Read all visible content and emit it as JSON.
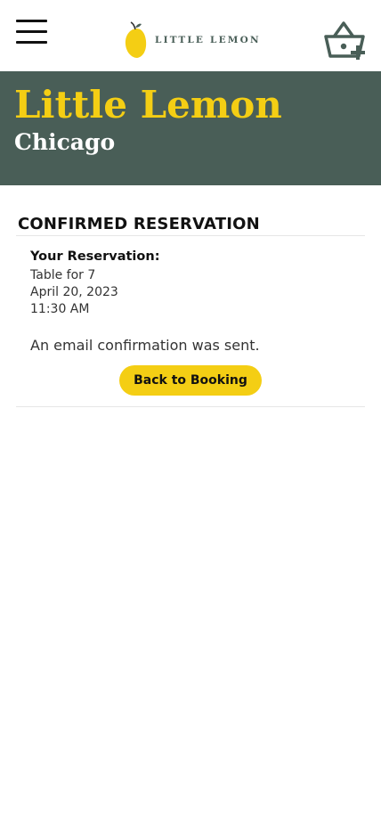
{
  "header": {
    "menu_label": "Menu",
    "logo_text": "LITTLE LEMON",
    "basket_label": "Add to basket"
  },
  "hero": {
    "title": "Little Lemon",
    "subtitle": "Chicago"
  },
  "confirmation": {
    "heading": "CONFIRMED RESERVATION",
    "label": "Your Reservation:",
    "table": "Table for 7",
    "date": "April 20, 2023",
    "time": "11:30 AM",
    "email_note": "An email confirmation was sent.",
    "back_button": "Back to Booking"
  },
  "colors": {
    "primary_green": "#495e57",
    "primary_yellow": "#f4ce14"
  }
}
